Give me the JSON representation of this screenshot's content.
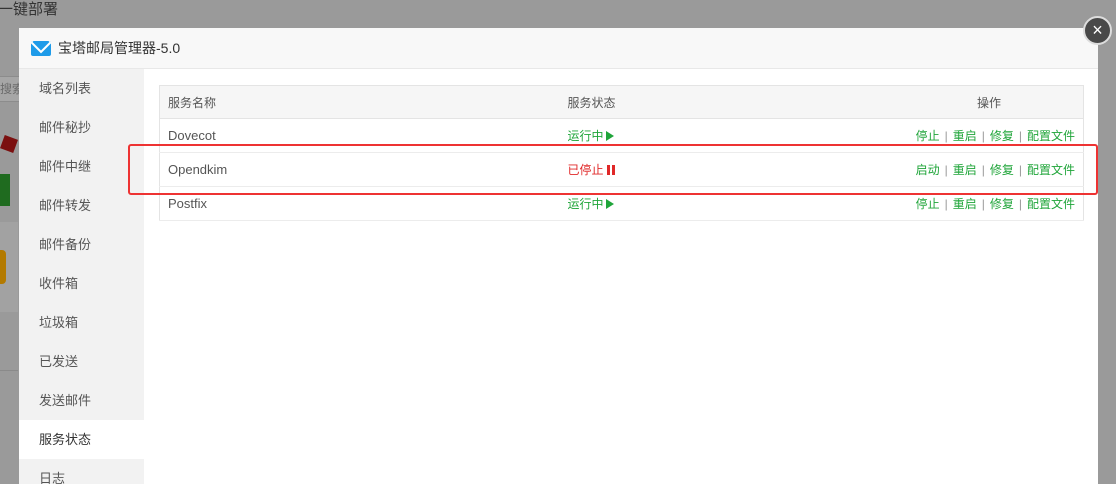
{
  "background": {
    "title": "一键部署",
    "search_placeholder": "搜索"
  },
  "modal": {
    "title": "宝塔邮局管理器-5.0",
    "close_symbol": "×",
    "icon": "mail-icon"
  },
  "sidebar": {
    "items": [
      {
        "label": "域名列表"
      },
      {
        "label": "邮件秘抄"
      },
      {
        "label": "邮件中继"
      },
      {
        "label": "邮件转发"
      },
      {
        "label": "邮件备份"
      },
      {
        "label": "收件箱"
      },
      {
        "label": "垃圾箱"
      },
      {
        "label": "已发送"
      },
      {
        "label": "发送邮件"
      },
      {
        "label": "服务状态"
      },
      {
        "label": "日志"
      }
    ],
    "active_index": 9
  },
  "table": {
    "headers": {
      "name": "服务名称",
      "status": "服务状态",
      "ops": "操作"
    },
    "rows": [
      {
        "name": "Dovecot",
        "status": "运行中",
        "state": "running",
        "action1": "停止",
        "action2": "重启",
        "action3": "修复",
        "action4": "配置文件"
      },
      {
        "name": "Opendkim",
        "status": "已停止",
        "state": "stopped",
        "action1": "启动",
        "action2": "重启",
        "action3": "修复",
        "action4": "配置文件"
      },
      {
        "name": "Postfix",
        "status": "运行中",
        "state": "running",
        "action1": "停止",
        "action2": "重启",
        "action3": "修复",
        "action4": "配置文件"
      }
    ]
  },
  "colors": {
    "running": "#20a53a",
    "stopped": "#e02828",
    "highlight": "#ee3333",
    "accent": "#1e9be9"
  }
}
